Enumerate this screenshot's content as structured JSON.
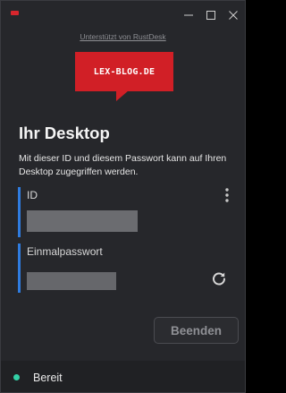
{
  "window": {
    "controls": {
      "minimize_icon": "minimize-icon",
      "maximize_icon": "maximize-icon",
      "close_icon": "close-icon"
    }
  },
  "powered_by": "Unterstützt von RustDesk",
  "logo": {
    "text": "LEX-BLOG.DE",
    "color": "#d11f26"
  },
  "main": {
    "title": "Ihr Desktop",
    "description": "Mit dieser ID und diesem Passwort kann auf Ihren Desktop zugegriffen werden.",
    "id_field": {
      "label": "ID",
      "menu_icon": "more-vertical-icon"
    },
    "password_field": {
      "label": "Einmalpasswort",
      "refresh_icon": "refresh-icon"
    },
    "stop_button": "Beenden"
  },
  "status": {
    "text": "Bereit",
    "color": "#33d0a6"
  },
  "colors": {
    "accent": "#2f7ce0",
    "background": "#26272b"
  }
}
